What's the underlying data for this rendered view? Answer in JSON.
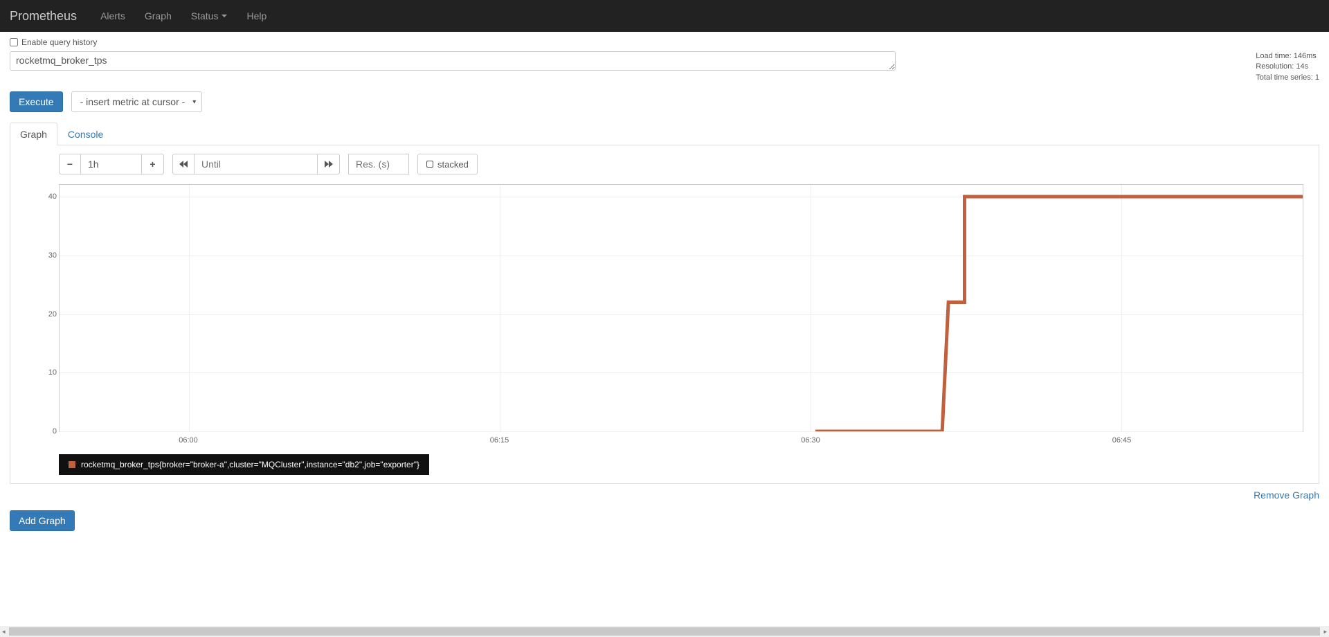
{
  "nav": {
    "brand": "Prometheus",
    "items": [
      "Alerts",
      "Graph",
      "Status",
      "Help"
    ]
  },
  "enable_history_label": "Enable query history",
  "query": "rocketmq_broker_tps",
  "stats": {
    "load_time": "Load time: 146ms",
    "resolution": "Resolution: 14s",
    "total_series": "Total time series: 1"
  },
  "execute_label": "Execute",
  "metric_select_label": "- insert metric at cursor -",
  "tabs": {
    "graph": "Graph",
    "console": "Console"
  },
  "range_value": "1h",
  "until_placeholder": "Until",
  "res_placeholder": "Res. (s)",
  "stacked_label": "stacked",
  "legend_text": "rocketmq_broker_tps{broker=\"broker-a\",cluster=\"MQCluster\",instance=\"db2\",job=\"exporter\"}",
  "remove_label": "Remove Graph",
  "add_graph_label": "Add Graph",
  "chart_data": {
    "type": "line",
    "x_categories": [
      "06:00",
      "06:15",
      "06:30",
      "06:45"
    ],
    "y_ticks": [
      0,
      10,
      20,
      30,
      40
    ],
    "ylim": [
      0,
      42
    ],
    "series": [
      {
        "name": "rocketmq_broker_tps{broker=\"broker-a\",cluster=\"MQCluster\",instance=\"db2\",job=\"exporter\"}",
        "color": "#c0603f",
        "points": [
          {
            "x_frac": 0.608,
            "y": 0
          },
          {
            "x_frac": 0.71,
            "y": 0
          },
          {
            "x_frac": 0.715,
            "y": 22
          },
          {
            "x_frac": 0.728,
            "y": 22
          },
          {
            "x_frac": 0.728,
            "y": 40
          },
          {
            "x_frac": 1.0,
            "y": 40
          }
        ]
      }
    ],
    "x_tick_fracs": [
      0.104,
      0.354,
      0.604,
      0.854
    ]
  }
}
